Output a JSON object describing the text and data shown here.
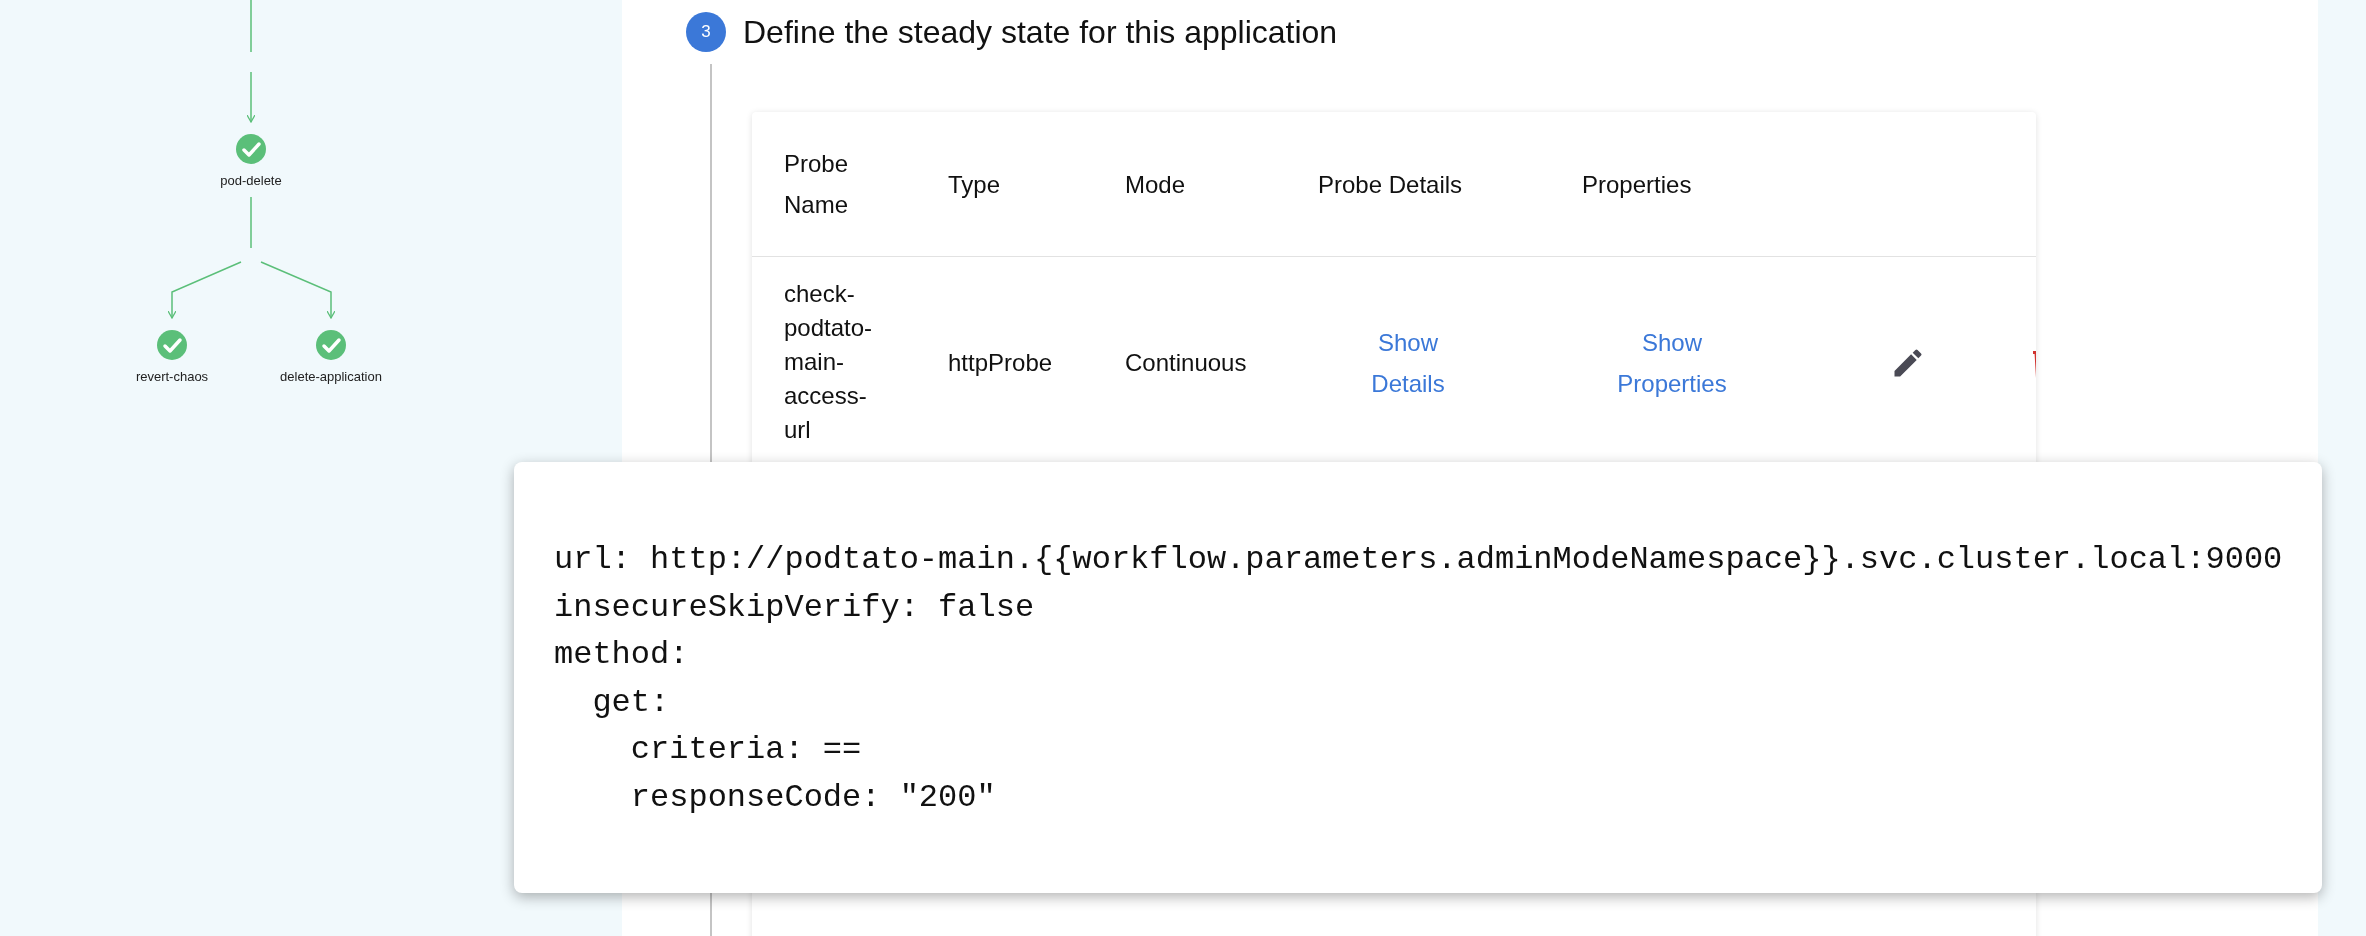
{
  "workflow_graph": {
    "nodes": [
      {
        "label": "pod-delete",
        "completed": true
      },
      {
        "label": "revert-chaos",
        "completed": true
      },
      {
        "label": "delete-application",
        "completed": true
      }
    ]
  },
  "step": {
    "number": "3",
    "title": "Define the steady state for this application"
  },
  "probe_table": {
    "columns": [
      "Probe Name",
      "Type",
      "Mode",
      "Probe Details",
      "Properties"
    ],
    "rows": [
      {
        "probe_name": "check-podtato-main-access-url",
        "type": "httpProbe",
        "mode": "Continuous",
        "probe_details": "Show Details",
        "properties": "Show Properties"
      }
    ]
  },
  "code_popover": {
    "lines": [
      "url: http://podtato-main.{{workflow.parameters.adminModeNamespace}}.svc.cluster.local:9000",
      "insecureSkipVerify: false",
      "method:",
      "  get:",
      "    criteria: ==",
      "    responseCode: \"200\""
    ]
  }
}
